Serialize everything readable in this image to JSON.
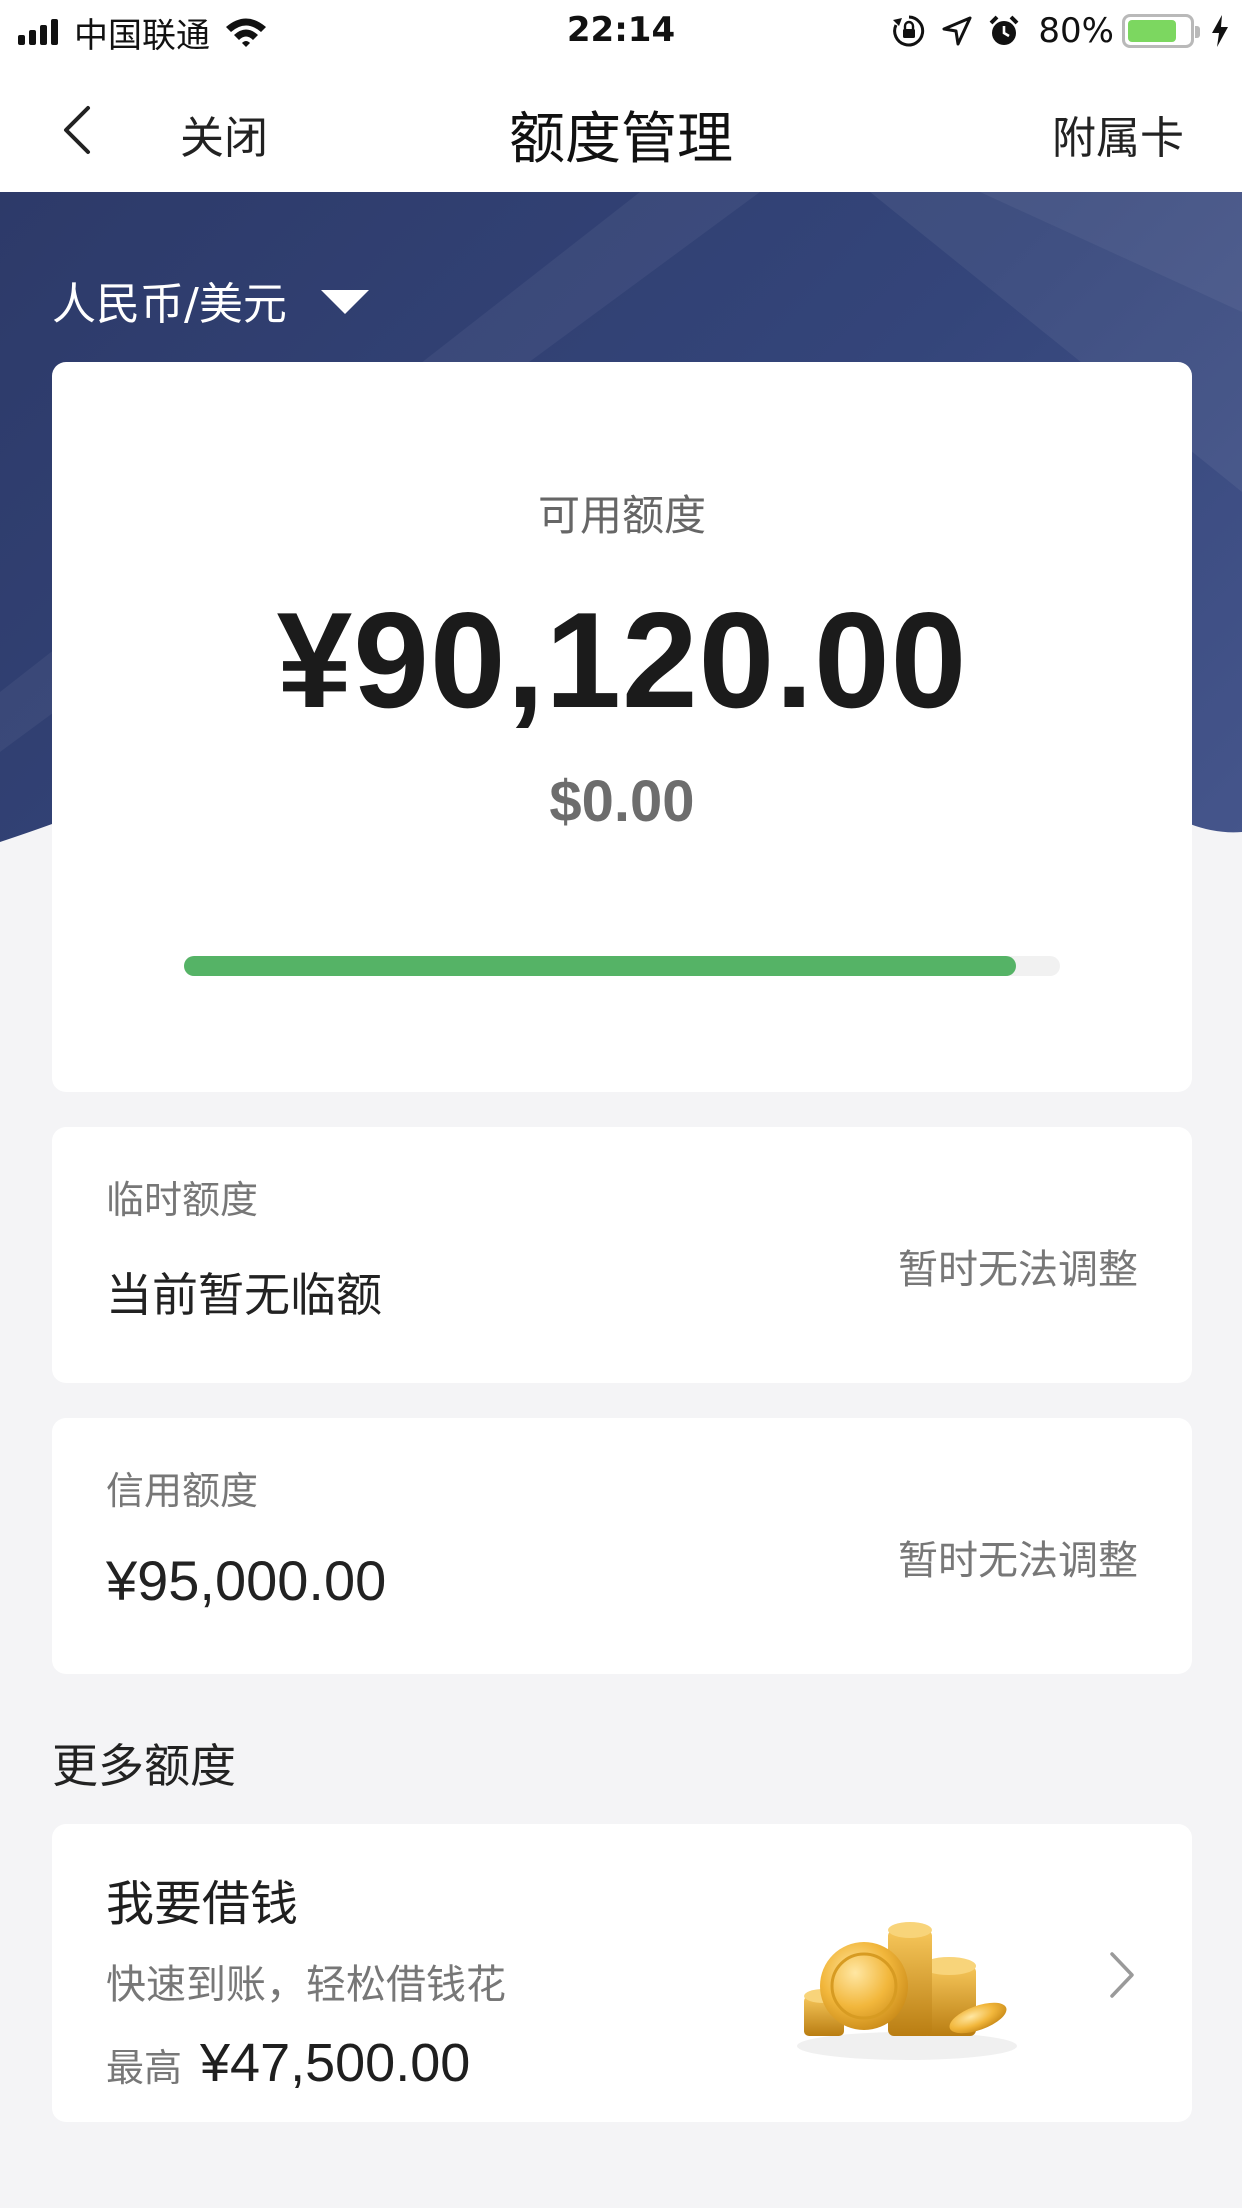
{
  "status_bar": {
    "carrier": "中国联通",
    "time": "22:14",
    "battery_percent": "80%",
    "battery_level": 0.8
  },
  "nav": {
    "close_label": "关闭",
    "title": "额度管理",
    "right_label": "附属卡"
  },
  "currency_selector": {
    "label": "人民币/美元"
  },
  "available": {
    "label": "可用额度",
    "cny_amount": "¥90,120.00",
    "usd_amount": "$0.00",
    "usage_progress": 0.95
  },
  "temporary_limit": {
    "label": "临时额度",
    "value": "当前暂无临额",
    "action": "暂时无法调整"
  },
  "credit_limit": {
    "label": "信用额度",
    "value": "¥95,000.00",
    "action": "暂时无法调整"
  },
  "more_section": {
    "title": "更多额度"
  },
  "loan_offer": {
    "title": "我要借钱",
    "subtitle": "快速到账，轻松借钱花",
    "max_label": "最高",
    "max_value": "¥47,500.00"
  },
  "colors": {
    "hero": "#34457a",
    "progress": "#55b366",
    "battery": "#7cd760"
  },
  "icons": [
    "back-arrow-icon",
    "wifi-icon",
    "signal-icon",
    "orientation-lock-icon",
    "location-icon",
    "alarm-icon",
    "charging-icon",
    "dropdown-caret-icon",
    "coins-icon",
    "chevron-right-icon"
  ]
}
